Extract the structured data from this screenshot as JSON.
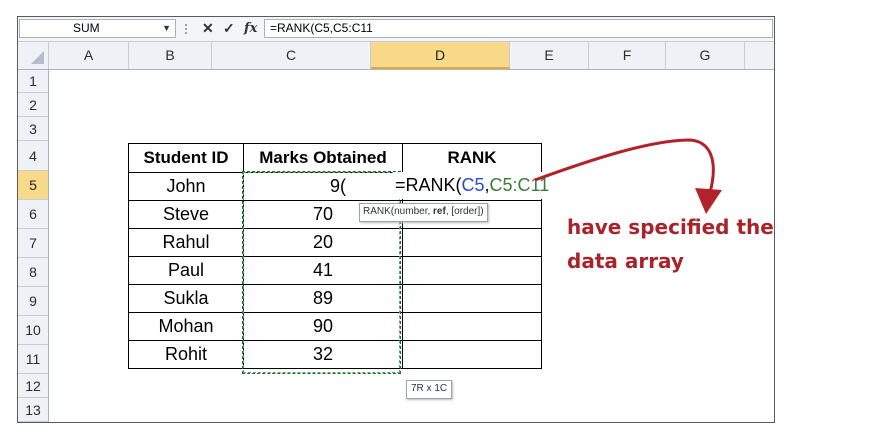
{
  "formula_bar": {
    "name_box": "SUM",
    "cancel_icon": "✕",
    "enter_icon": "✓",
    "fx_label": "fx",
    "formula": "=RANK(C5,C5:C11"
  },
  "columns": [
    "A",
    "B",
    "C",
    "D",
    "E",
    "F",
    "G"
  ],
  "selected_column": "D",
  "rows": [
    "1",
    "2",
    "3",
    "4",
    "5",
    "6",
    "7",
    "8",
    "9",
    "10",
    "11",
    "12",
    "13"
  ],
  "selected_row": "5",
  "table": {
    "headers": [
      "Student ID",
      "Marks Obtained",
      "RANK"
    ],
    "rows": [
      {
        "student": "John",
        "marks": "9("
      },
      {
        "student": "Steve",
        "marks": "70"
      },
      {
        "student": "Rahul",
        "marks": "20"
      },
      {
        "student": "Paul",
        "marks": "41"
      },
      {
        "student": "Sukla",
        "marks": "89"
      },
      {
        "student": "Mohan",
        "marks": "90"
      },
      {
        "student": "Rohit",
        "marks": "32"
      }
    ]
  },
  "edit_cell": {
    "prefix": "=RANK(",
    "ref1": "C5",
    "comma": ",",
    "ref2": "C5:C11"
  },
  "tooltip": {
    "fn": "RANK(number, ",
    "bold_arg": "ref",
    "rest": ", [order])"
  },
  "size_tooltip": "7R x 1C",
  "annotation": {
    "line1": "have specified the",
    "line2": "data array"
  },
  "colors": {
    "ref1": "#2a4fbf",
    "ref2": "#3b7a3b",
    "annotation": "#a8232a",
    "selected_header": "#f9d98a"
  }
}
